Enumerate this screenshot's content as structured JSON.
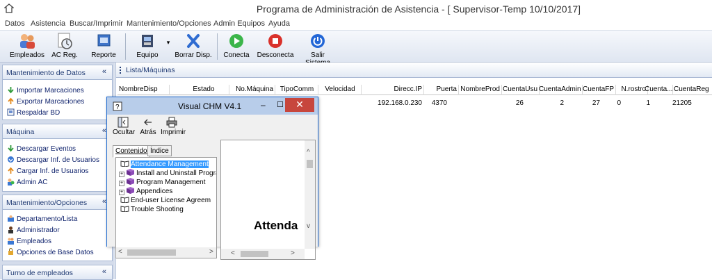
{
  "window": {
    "title": "Programa de Administración de Asistencia - [ Supervisor-Temp 10/10/2017]"
  },
  "menu": [
    "Datos",
    "Asistencia",
    "Buscar/Imprimir",
    "Mantenimiento/Opciones",
    "Admin Equipos",
    "Ayuda"
  ],
  "toolbar": {
    "empleados": "Empleados",
    "ac_reg": "AC Reg.",
    "reporte": "Reporte",
    "equipo": "Equipo",
    "borrar": "Borrar Disp.",
    "conecta": "Conecta",
    "desconecta": "Desconecta",
    "salir": "Salir Sistema"
  },
  "sidebar": {
    "groups": [
      {
        "title": "Mantenimiento de Datos",
        "items": [
          "Importar Marcaciones",
          "Exportar Marcaciones",
          "Respaldar BD"
        ]
      },
      {
        "title": "Máquina",
        "items": [
          "Descargar Eventos",
          "Descargar Inf. de Usuarios",
          "Cargar Inf. de Usuarios",
          "Admin AC"
        ]
      },
      {
        "title": "Mantenimiento/Opciones",
        "items": [
          "Departamento/Lista",
          "Administrador",
          "Empleados",
          "Opciones de Base Datos"
        ]
      },
      {
        "title": "Turno de empleados",
        "items": []
      }
    ],
    "collapse_glyph": "«"
  },
  "main": {
    "header": "Lista/Máquinas",
    "columns": [
      "NombreDisp",
      "Estado",
      "No.Máquina",
      "TipoComm",
      "Velocidad",
      "Direcc.IP",
      "Puerta",
      "NombreProd",
      "CuentaUsu",
      "CuentaAdmin",
      "CuentaFP",
      "N.rostro",
      "Cuenta...",
      "CuentaReg"
    ],
    "row": [
      "",
      "",
      "",
      "",
      "",
      "192.168.0.230",
      "4370",
      "",
      "26",
      "2",
      "27",
      "0",
      "1",
      "21205"
    ]
  },
  "chm": {
    "title": "Visual CHM V4.1",
    "toolbar": {
      "ocultar": "Ocultar",
      "atras": "Atrás",
      "imprimir": "Imprimir"
    },
    "tabs": [
      "Contenido",
      "Índice"
    ],
    "tree": [
      "Attendance Management",
      "Install and Uninstall Progra",
      "Program Management",
      "Appendices",
      "End-user License Agreem",
      "Trouble Shooting"
    ],
    "content_text": "Attenda"
  },
  "colors": {
    "accent": "#1f3a73",
    "close": "#c7463d",
    "selection": "#3399ff"
  }
}
